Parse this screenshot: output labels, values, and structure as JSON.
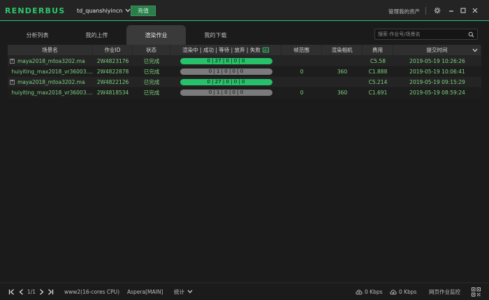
{
  "app": {
    "logo": "RENDERBUS",
    "username": "td_quanshiyincn",
    "recharge_label": "充值",
    "manage_assets_label": "管理我的资产",
    "accent_color": "#2ec66a"
  },
  "tabs": [
    {
      "label": "分析列表",
      "active": false
    },
    {
      "label": "我的上传",
      "active": false
    },
    {
      "label": "渲染作业",
      "active": true
    },
    {
      "label": "我的下载",
      "active": false
    }
  ],
  "search": {
    "placeholder": "搜索 作业号/场景名"
  },
  "table": {
    "headers": [
      "场景名",
      "作业ID",
      "状态",
      "渲染中 | 成功 | 等待 | 放弃 | 失败",
      "帧范围",
      "渲染相机",
      "费用",
      "提交时间"
    ],
    "rows": [
      {
        "expandable": true,
        "scene": "maya2018_mtoa3202.ma",
        "job_id": "2W4823176",
        "status": "已完成",
        "progress": "0 | 27 | 0 | 0 | 0",
        "bar": "green",
        "frame": "",
        "camera": "",
        "cost": "C5.58",
        "time": "2019-05-19 10:26:26"
      },
      {
        "expandable": false,
        "scene": "huiyiting_max2018_vr36003....",
        "job_id": "2W4822878",
        "status": "已完成",
        "progress": "0 | 1 | 0 | 0 | 0",
        "bar": "gray",
        "frame": "0",
        "camera": "360",
        "cost": "C1.888",
        "time": "2019-05-19 10:06:41"
      },
      {
        "expandable": true,
        "scene": "maya2018_mtoa3202.ma",
        "job_id": "2W4822126",
        "status": "已完成",
        "progress": "0 | 27 | 0 | 0 | 0",
        "bar": "green",
        "frame": "",
        "camera": "",
        "cost": "C5.214",
        "time": "2019-05-19 09:15:29"
      },
      {
        "expandable": false,
        "scene": "huiyiting_max2018_vr36003....",
        "job_id": "2W4818534",
        "status": "已完成",
        "progress": "0 | 1 | 0 | 0 | 0",
        "bar": "gray",
        "frame": "0",
        "camera": "360",
        "cost": "C1.691",
        "time": "2019-05-19 08:59:24"
      }
    ]
  },
  "footer": {
    "page": "1/1",
    "server": "www2(16-cores CPU)",
    "transfer": "Aspera[MAIN]",
    "stats_label": "统计",
    "upload_speed": "0 Kbps",
    "download_speed": "0 Kbps",
    "web_monitor": "网页作业监控"
  }
}
